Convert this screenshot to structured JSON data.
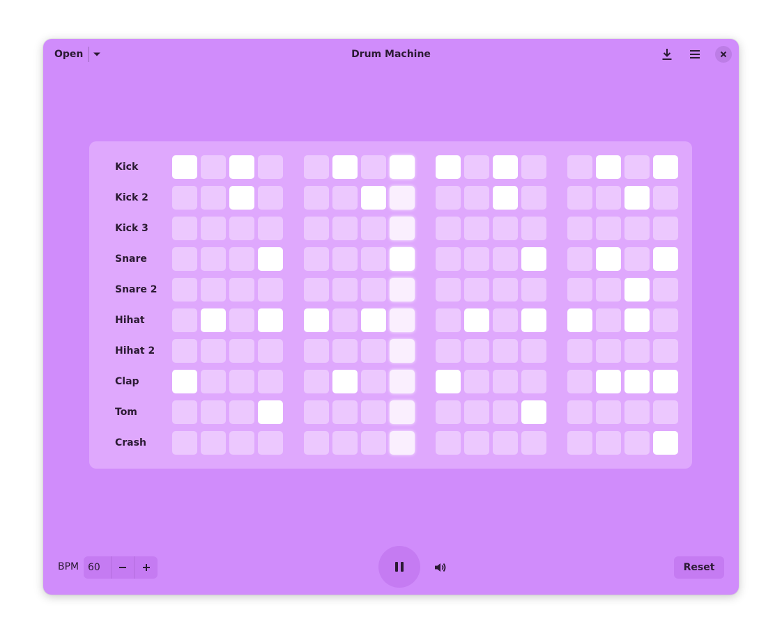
{
  "window": {
    "title": "Drum Machine",
    "background": "#d08cfb"
  },
  "header": {
    "open_label": "Open",
    "icons": {
      "dropdown": "chevron-down-icon",
      "download": "download-icon",
      "menu": "hamburger-menu-icon",
      "close": "close-icon"
    }
  },
  "sequencer": {
    "steps": 16,
    "current_step": 8,
    "rows": [
      {
        "label": "Kick",
        "pattern": [
          1,
          0,
          1,
          0,
          0,
          1,
          0,
          1,
          1,
          0,
          1,
          0,
          0,
          1,
          0,
          1
        ]
      },
      {
        "label": "Kick 2",
        "pattern": [
          0,
          0,
          1,
          0,
          0,
          0,
          1,
          0,
          0,
          0,
          1,
          0,
          0,
          0,
          1,
          0
        ]
      },
      {
        "label": "Kick 3",
        "pattern": [
          0,
          0,
          0,
          0,
          0,
          0,
          0,
          0,
          0,
          0,
          0,
          0,
          0,
          0,
          0,
          0
        ]
      },
      {
        "label": "Snare",
        "pattern": [
          0,
          0,
          0,
          1,
          0,
          0,
          0,
          1,
          0,
          0,
          0,
          1,
          0,
          1,
          0,
          1
        ]
      },
      {
        "label": "Snare 2",
        "pattern": [
          0,
          0,
          0,
          0,
          0,
          0,
          0,
          0,
          0,
          0,
          0,
          0,
          0,
          0,
          1,
          0
        ]
      },
      {
        "label": "Hihat",
        "pattern": [
          0,
          1,
          0,
          1,
          1,
          0,
          1,
          0,
          0,
          1,
          0,
          1,
          1,
          0,
          1,
          0
        ]
      },
      {
        "label": "Hihat 2",
        "pattern": [
          0,
          0,
          0,
          0,
          0,
          0,
          0,
          0,
          0,
          0,
          0,
          0,
          0,
          0,
          0,
          0
        ]
      },
      {
        "label": "Clap",
        "pattern": [
          1,
          0,
          0,
          0,
          0,
          1,
          0,
          0,
          1,
          0,
          0,
          0,
          0,
          1,
          1,
          1
        ]
      },
      {
        "label": "Tom",
        "pattern": [
          0,
          0,
          0,
          1,
          0,
          0,
          0,
          0,
          0,
          0,
          0,
          1,
          0,
          0,
          0,
          0
        ]
      },
      {
        "label": "Crash",
        "pattern": [
          0,
          0,
          0,
          0,
          0,
          0,
          0,
          0,
          0,
          0,
          0,
          0,
          0,
          0,
          0,
          1
        ]
      }
    ]
  },
  "footer": {
    "bpm_label": "BPM",
    "bpm_value": "60",
    "decrement_icon": "minus-icon",
    "increment_icon": "plus-icon",
    "play_icon": "pause-icon",
    "volume_icon": "volume-icon",
    "reset_label": "Reset"
  }
}
